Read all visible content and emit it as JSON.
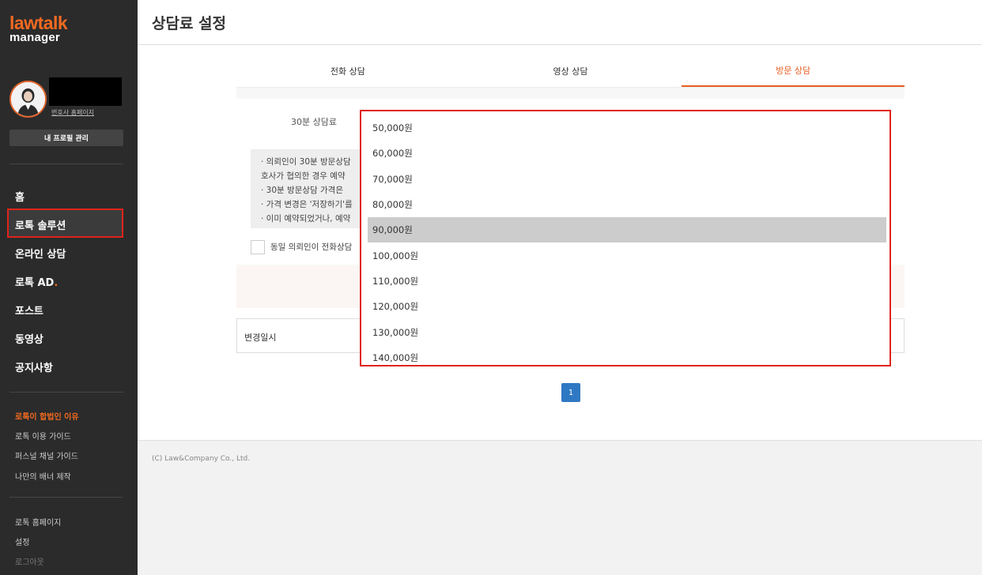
{
  "sidebar": {
    "logo_top": "lawtalk",
    "logo_bottom": "manager",
    "homepage_link": "변호사 홈페이지",
    "profile_button": "내 프로필 관리",
    "nav": [
      {
        "label": "홈"
      },
      {
        "label": "로톡 솔루션"
      },
      {
        "label": "온라인 상담"
      },
      {
        "label": "로톡 AD",
        "dot": "."
      },
      {
        "label": "포스트"
      },
      {
        "label": "동영상"
      },
      {
        "label": "공지사항"
      }
    ],
    "links": [
      {
        "label": "로톡이 합법인 이유"
      },
      {
        "label": "로톡 이용 가이드"
      },
      {
        "label": "퍼스널 채널 가이드"
      },
      {
        "label": "나만의 배너 제작"
      }
    ],
    "bottom_links": [
      {
        "label": "로톡 홈페이지"
      },
      {
        "label": "설정"
      },
      {
        "label": "로그아웃"
      }
    ]
  },
  "header": {
    "title": "상담료 설정"
  },
  "tabs": [
    {
      "label": "전화 상담"
    },
    {
      "label": "영상 상담"
    },
    {
      "label": "방문 상담"
    }
  ],
  "form": {
    "fee_label": "30분 상담료",
    "notices": [
      "·  의뢰인이 30분 방문상담",
      "    호사가 협의한 경우 예약",
      "·  30분 방문상담 가격은 ",
      "·  가격 변경은 '저장하기'를",
      "·  이미 예약되었거나, 예약"
    ],
    "checkbox_label": "동일 의뢰인이 전화상담"
  },
  "history": {
    "label": "변경일시"
  },
  "pagination": {
    "current": "1"
  },
  "dropdown": {
    "options": [
      {
        "label": "50,000원"
      },
      {
        "label": "60,000원"
      },
      {
        "label": "70,000원"
      },
      {
        "label": "80,000원"
      },
      {
        "label": "90,000원"
      },
      {
        "label": "100,000원"
      },
      {
        "label": "110,000원"
      },
      {
        "label": "120,000원"
      },
      {
        "label": "130,000원"
      },
      {
        "label": "140,000원"
      }
    ],
    "highlighted": "90,000원"
  },
  "footer": {
    "copyright": "(C) Law&Company Co., Ltd."
  },
  "colors": {
    "accent": "#e85d22",
    "sidebar": "#2b2b2b",
    "highlight_border": "#e0241b",
    "page_button": "#2f78c3"
  }
}
